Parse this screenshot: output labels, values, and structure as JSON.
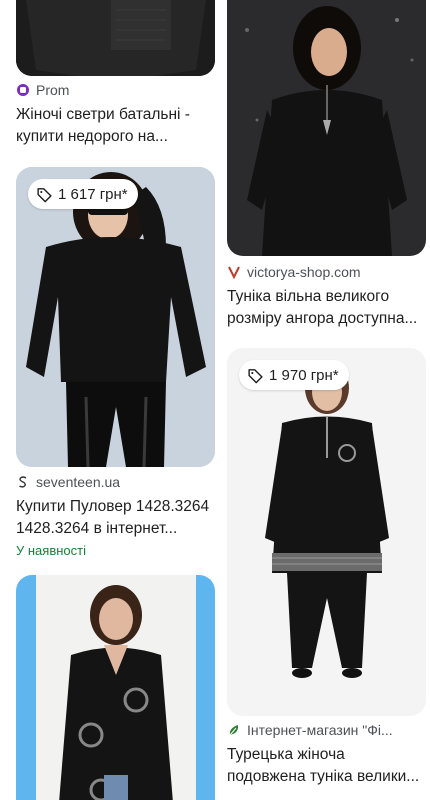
{
  "colors": {
    "accent_available": "#188038",
    "prom_purple": "#7b2cbf",
    "victorya_red": "#c0392b"
  },
  "cards": {
    "prom": {
      "source": "Prom",
      "source_icon": "prom-circle-icon",
      "title_line1": "Жіночі светри батальні -",
      "title_line2": "купити недорого на..."
    },
    "seventeen": {
      "price": "1 617 грн*",
      "source": "seventeen.ua",
      "source_icon": "seventeen-s-icon",
      "title_line1": "Купити Пуловер 1428.3264",
      "title_line2": "1428.3264 в інтернет...",
      "availability": "У наявності"
    },
    "victorya": {
      "source": "victorya-shop.com",
      "source_icon": "victorya-v-icon",
      "title_line1": "Туніка вільна великого",
      "title_line2": "розміру ангора доступна..."
    },
    "internet_shop": {
      "price": "1 970 грн*",
      "source": "Інтернет-магазин \"Фі...",
      "source_icon": "shop-leaf-icon",
      "title_line1": "Турецька жіноча",
      "title_line2": "подовжена туніка велики..."
    }
  }
}
